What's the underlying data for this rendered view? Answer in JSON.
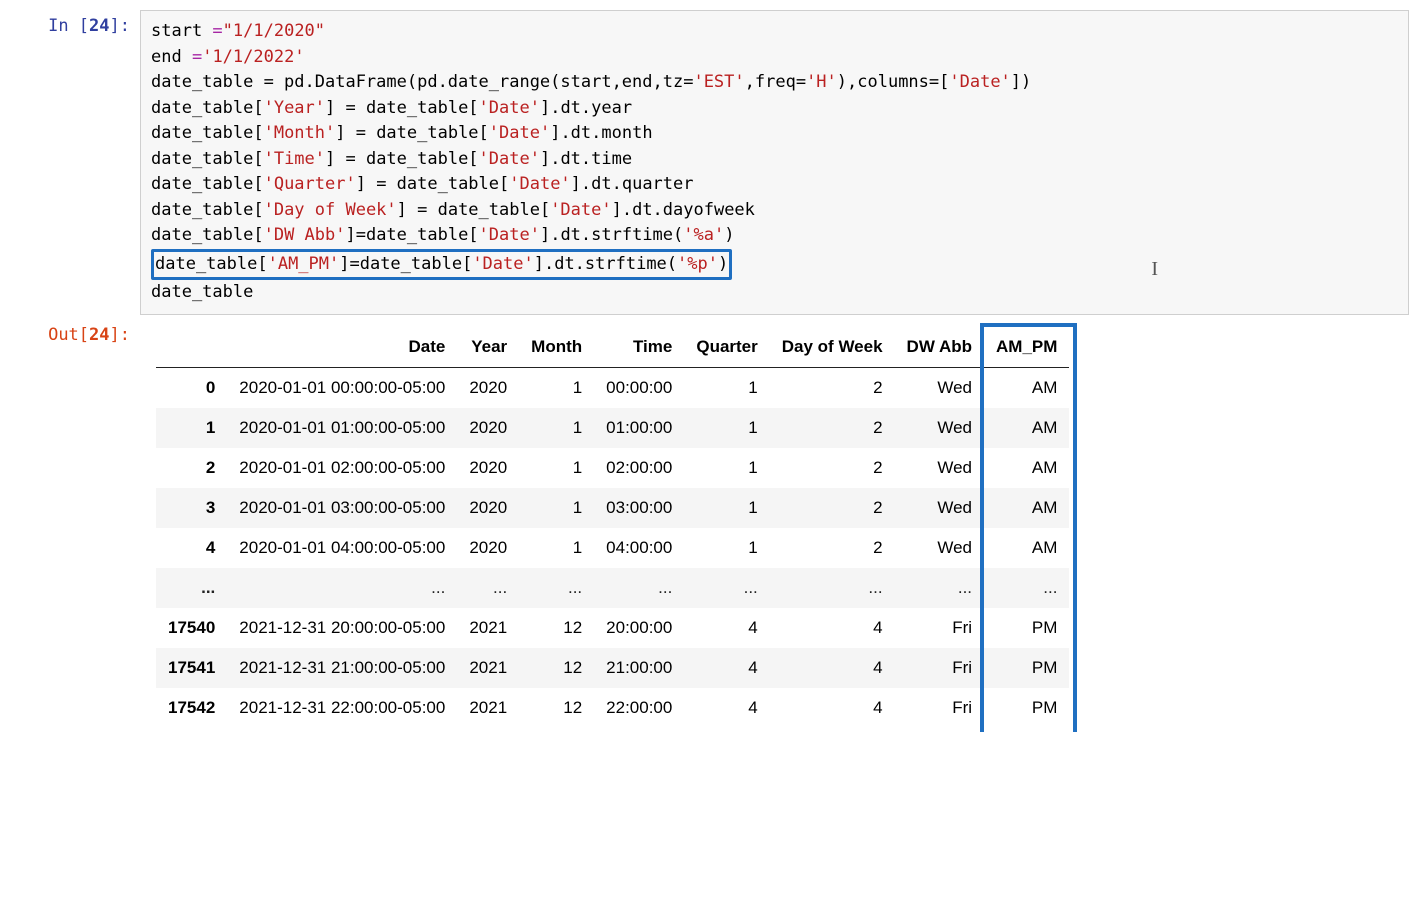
{
  "prompts": {
    "in_label": "In [",
    "out_label": "Out[",
    "close": "]:",
    "exec_count": "24"
  },
  "code": {
    "l1_a": "start ",
    "l1_op": "=",
    "l1_str": "\"1/1/2020\"",
    "l2_a": "end ",
    "l2_op": "=",
    "l2_str": "'1/1/2022'",
    "l3": "date_table = pd.DataFrame(pd.date_range(start,end,tz=",
    "l3_s1": "'EST'",
    "l3_b": ",freq=",
    "l3_s2": "'H'",
    "l3_c": "),columns=[",
    "l3_s3": "'Date'",
    "l3_d": "])",
    "l4_a": "date_table[",
    "l4_s1": "'Year'",
    "l4_b": "] = date_table[",
    "l4_s2": "'Date'",
    "l4_c": "].dt.year",
    "l5_a": "date_table[",
    "l5_s1": "'Month'",
    "l5_b": "] = date_table[",
    "l5_s2": "'Date'",
    "l5_c": "].dt.month",
    "l6_a": "date_table[",
    "l6_s1": "'Time'",
    "l6_b": "] = date_table[",
    "l6_s2": "'Date'",
    "l6_c": "].dt.time",
    "l7_a": "date_table[",
    "l7_s1": "'Quarter'",
    "l7_b": "] = date_table[",
    "l7_s2": "'Date'",
    "l7_c": "].dt.quarter",
    "l8_a": "date_table[",
    "l8_s1": "'Day of Week'",
    "l8_b": "] = date_table[",
    "l8_s2": "'Date'",
    "l8_c": "].dt.dayofweek",
    "l9_a": "date_table[",
    "l9_s1": "'DW Abb'",
    "l9_b": "]=date_table[",
    "l9_s2": "'Date'",
    "l9_c": "].dt.strftime(",
    "l9_s3": "'%a'",
    "l9_d": ")",
    "l10_a": "date_table[",
    "l10_s1": "'AM_PM'",
    "l10_b": "]=date_table[",
    "l10_s2": "'Date'",
    "l10_c": "].dt.strftime(",
    "l10_s3": "'%p'",
    "l10_d": ")",
    "l11": "date_table"
  },
  "table": {
    "columns": [
      "Date",
      "Year",
      "Month",
      "Time",
      "Quarter",
      "Day of Week",
      "DW Abb",
      "AM_PM"
    ],
    "rows": [
      {
        "idx": "0",
        "Date": "2020-01-01 00:00:00-05:00",
        "Year": "2020",
        "Month": "1",
        "Time": "00:00:00",
        "Quarter": "1",
        "Day of Week": "2",
        "DW Abb": "Wed",
        "AM_PM": "AM"
      },
      {
        "idx": "1",
        "Date": "2020-01-01 01:00:00-05:00",
        "Year": "2020",
        "Month": "1",
        "Time": "01:00:00",
        "Quarter": "1",
        "Day of Week": "2",
        "DW Abb": "Wed",
        "AM_PM": "AM"
      },
      {
        "idx": "2",
        "Date": "2020-01-01 02:00:00-05:00",
        "Year": "2020",
        "Month": "1",
        "Time": "02:00:00",
        "Quarter": "1",
        "Day of Week": "2",
        "DW Abb": "Wed",
        "AM_PM": "AM"
      },
      {
        "idx": "3",
        "Date": "2020-01-01 03:00:00-05:00",
        "Year": "2020",
        "Month": "1",
        "Time": "03:00:00",
        "Quarter": "1",
        "Day of Week": "2",
        "DW Abb": "Wed",
        "AM_PM": "AM"
      },
      {
        "idx": "4",
        "Date": "2020-01-01 04:00:00-05:00",
        "Year": "2020",
        "Month": "1",
        "Time": "04:00:00",
        "Quarter": "1",
        "Day of Week": "2",
        "DW Abb": "Wed",
        "AM_PM": "AM"
      },
      {
        "idx": "...",
        "Date": "...",
        "Year": "...",
        "Month": "...",
        "Time": "...",
        "Quarter": "...",
        "Day of Week": "...",
        "DW Abb": "...",
        "AM_PM": "..."
      },
      {
        "idx": "17540",
        "Date": "2021-12-31 20:00:00-05:00",
        "Year": "2021",
        "Month": "12",
        "Time": "20:00:00",
        "Quarter": "4",
        "Day of Week": "4",
        "DW Abb": "Fri",
        "AM_PM": "PM"
      },
      {
        "idx": "17541",
        "Date": "2021-12-31 21:00:00-05:00",
        "Year": "2021",
        "Month": "12",
        "Time": "21:00:00",
        "Quarter": "4",
        "Day of Week": "4",
        "DW Abb": "Fri",
        "AM_PM": "PM"
      },
      {
        "idx": "17542",
        "Date": "2021-12-31 22:00:00-05:00",
        "Year": "2021",
        "Month": "12",
        "Time": "22:00:00",
        "Quarter": "4",
        "Day of Week": "4",
        "DW Abb": "Fri",
        "AM_PM": "PM"
      }
    ]
  }
}
